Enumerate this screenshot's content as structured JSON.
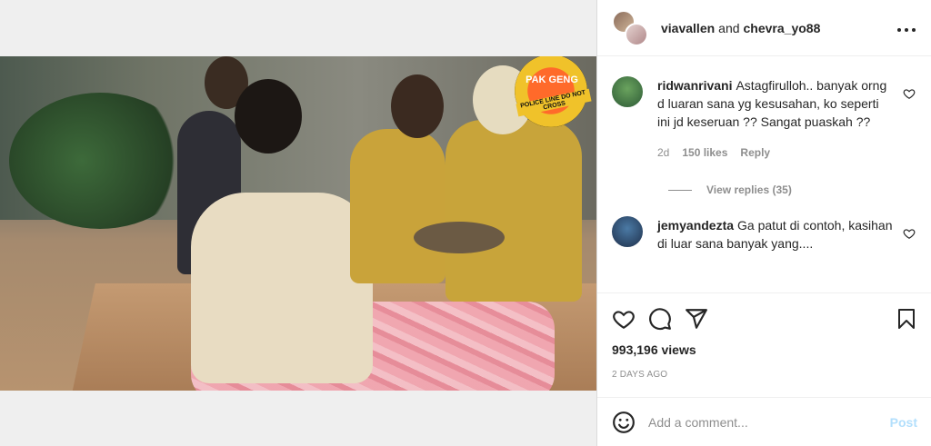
{
  "header": {
    "user1": "viavallen",
    "and_text": "and",
    "user2": "chevra_yo88"
  },
  "media": {
    "logo_text": "PAK GENG",
    "logo_sub": "POLICE LINE DO NOT CROSS"
  },
  "comments": [
    {
      "username": "ridwanrivani",
      "text": "Astagfirulloh.. banyak orng d luaran sana yg kesusahan, ko seperti ini jd keseruan ?? Sangat puaskah ??",
      "age": "2d",
      "likes": "150 likes",
      "reply": "Reply",
      "view_replies": "View replies (35)"
    },
    {
      "username": "jemyandezta",
      "text": "Ga patut di contoh, kasihan di luar sana banyak yang...."
    }
  ],
  "stats": {
    "views": "993,196 views",
    "posted": "2 DAYS AGO"
  },
  "add_comment": {
    "placeholder": "Add a comment...",
    "post_label": "Post"
  },
  "colors": {
    "link_disabled": "#b2dffc",
    "muted": "#8e8e8e",
    "text": "#262626"
  },
  "icons": [
    "heart-icon",
    "comment-icon",
    "share-icon",
    "bookmark-icon",
    "emoji-icon",
    "more-icon"
  ]
}
